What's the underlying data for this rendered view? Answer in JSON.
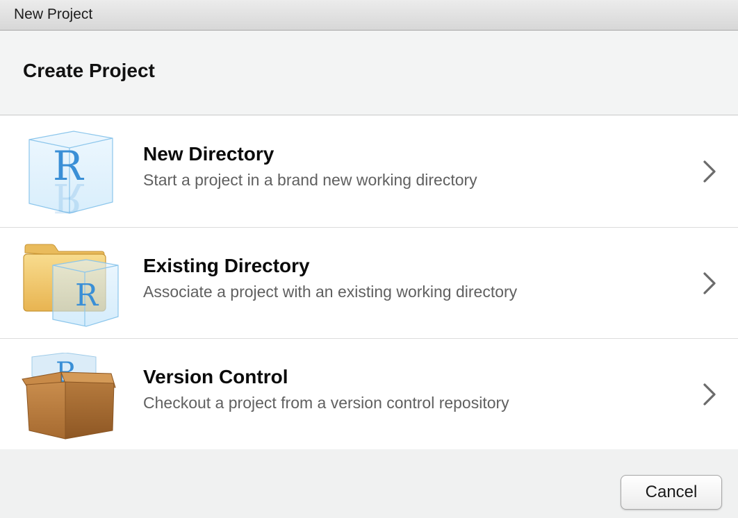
{
  "window": {
    "title": "New Project"
  },
  "header": {
    "title": "Create Project"
  },
  "options": [
    {
      "label": "New Directory",
      "description": "Start a project in a brand new working directory",
      "icon": "r-cube-icon"
    },
    {
      "label": "Existing Directory",
      "description": "Associate a project with an existing working directory",
      "icon": "folder-r-cube-icon"
    },
    {
      "label": "Version Control",
      "description": "Checkout a project from a version control repository",
      "icon": "box-r-cube-icon"
    }
  ],
  "footer": {
    "cancel_label": "Cancel"
  },
  "icon_letter": "R",
  "colors": {
    "r_blue": "#3a8fd6",
    "cube_blue": "#a9d7f5",
    "folder_yellow": "#f2c866",
    "box_brown": "#b87a3e"
  }
}
